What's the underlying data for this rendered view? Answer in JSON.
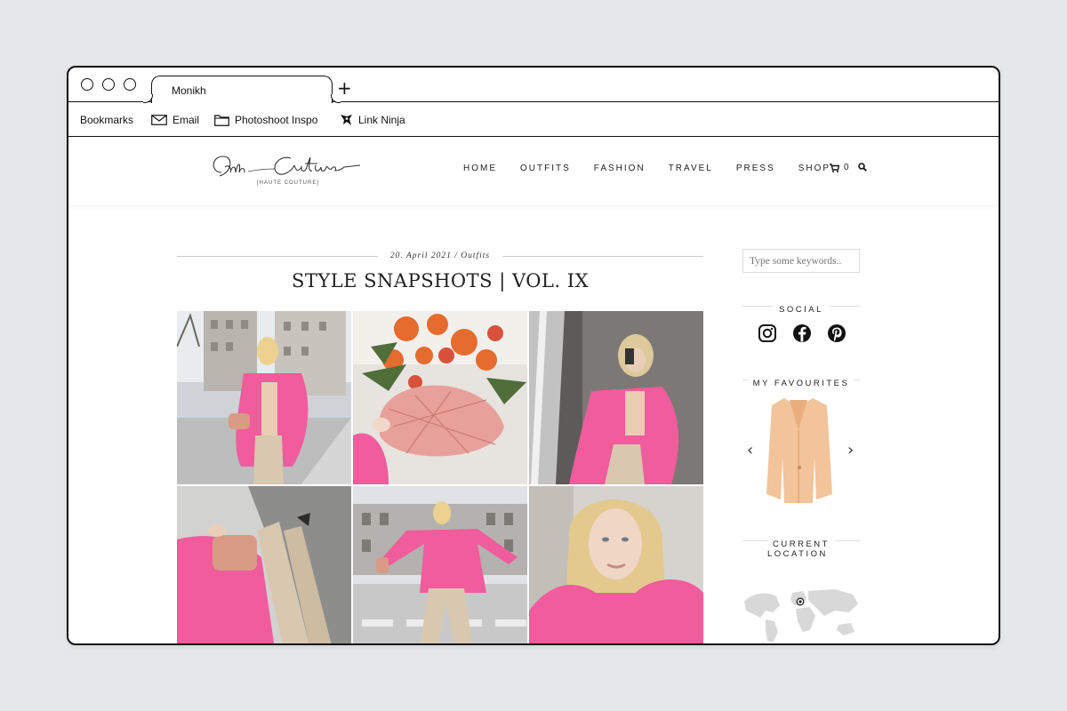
{
  "browser": {
    "tab_title": "Monikh",
    "new_tab_symbol": "+",
    "bookmarks": [
      {
        "label": "Bookmarks",
        "icon": "none"
      },
      {
        "label": "Email",
        "icon": "mail-icon"
      },
      {
        "label": "Photoshoot Inspo",
        "icon": "folder-icon"
      },
      {
        "label": "Link Ninja",
        "icon": "ninja-icon"
      }
    ]
  },
  "site": {
    "logo_script": "Ala Couture",
    "logo_tagline": "[HAUTE COUTURE]",
    "nav": [
      "HOME",
      "OUTFITS",
      "FASHION",
      "TRAVEL",
      "PRESS",
      "SHOP"
    ],
    "cart_count": "0"
  },
  "post": {
    "meta": "20. April 2021 / Outfits",
    "title": "STYLE SNAPSHOTS | VOL. IX",
    "photos": [
      {
        "name": "photo-street-pink-blazer"
      },
      {
        "name": "photo-flowers-woven-bag"
      },
      {
        "name": "photo-mirror-selfie"
      },
      {
        "name": "photo-from-above"
      },
      {
        "name": "photo-crosswalk"
      },
      {
        "name": "photo-portrait"
      }
    ]
  },
  "sidebar": {
    "search_placeholder": "Type some keywords..",
    "social_title": "SOCIAL",
    "social_icons": [
      "instagram-icon",
      "facebook-icon",
      "pinterest-icon"
    ],
    "favourites_title": "MY FAVOURITES",
    "location_title_line1": "CURRENT",
    "location_title_line2": "LOCATION"
  },
  "colors": {
    "pink": "#f05c9c",
    "beige": "#d8c8b0",
    "peach": "#f3c39a"
  }
}
